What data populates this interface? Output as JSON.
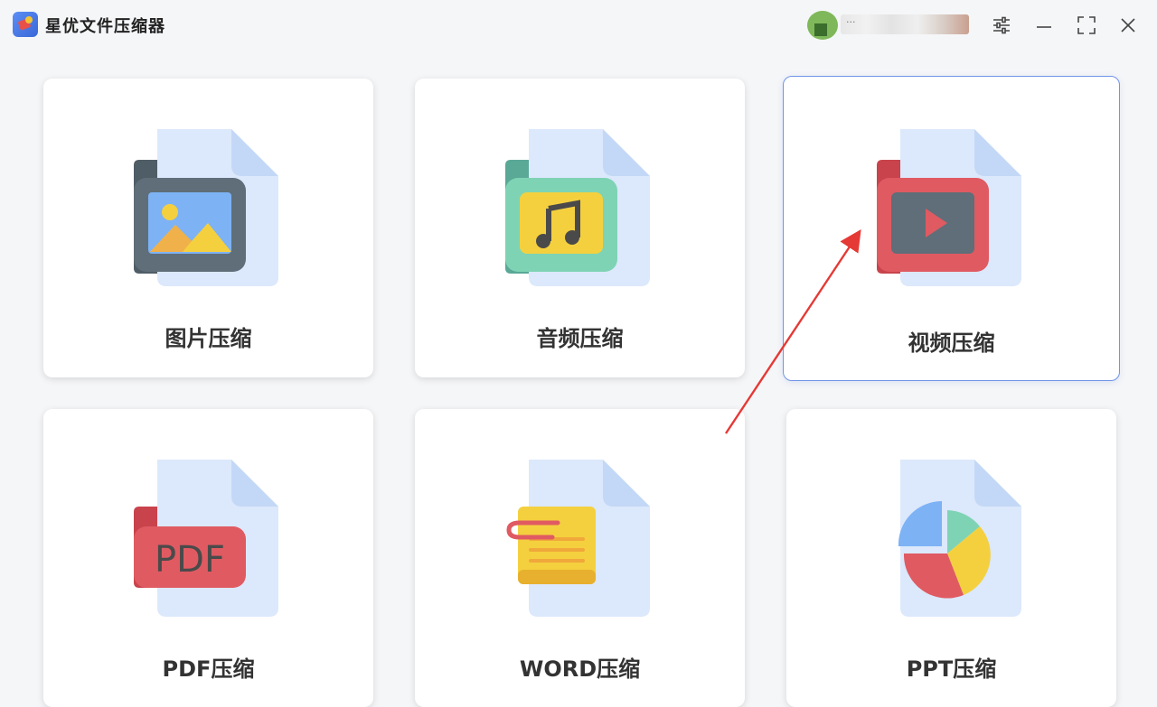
{
  "app": {
    "title": "星优文件压缩器"
  },
  "user": {
    "name": "···"
  },
  "cards": [
    {
      "label": "图片压缩"
    },
    {
      "label": "音频压缩"
    },
    {
      "label": "视频压缩"
    },
    {
      "label": "PDF压缩",
      "icon_text": "PDF"
    },
    {
      "label": "WORD压缩"
    },
    {
      "label": "PPT压缩"
    }
  ],
  "colors": {
    "selected_border": "#6f95e8",
    "arrow": "#e53935",
    "doc_bg": "#dce8fb"
  }
}
